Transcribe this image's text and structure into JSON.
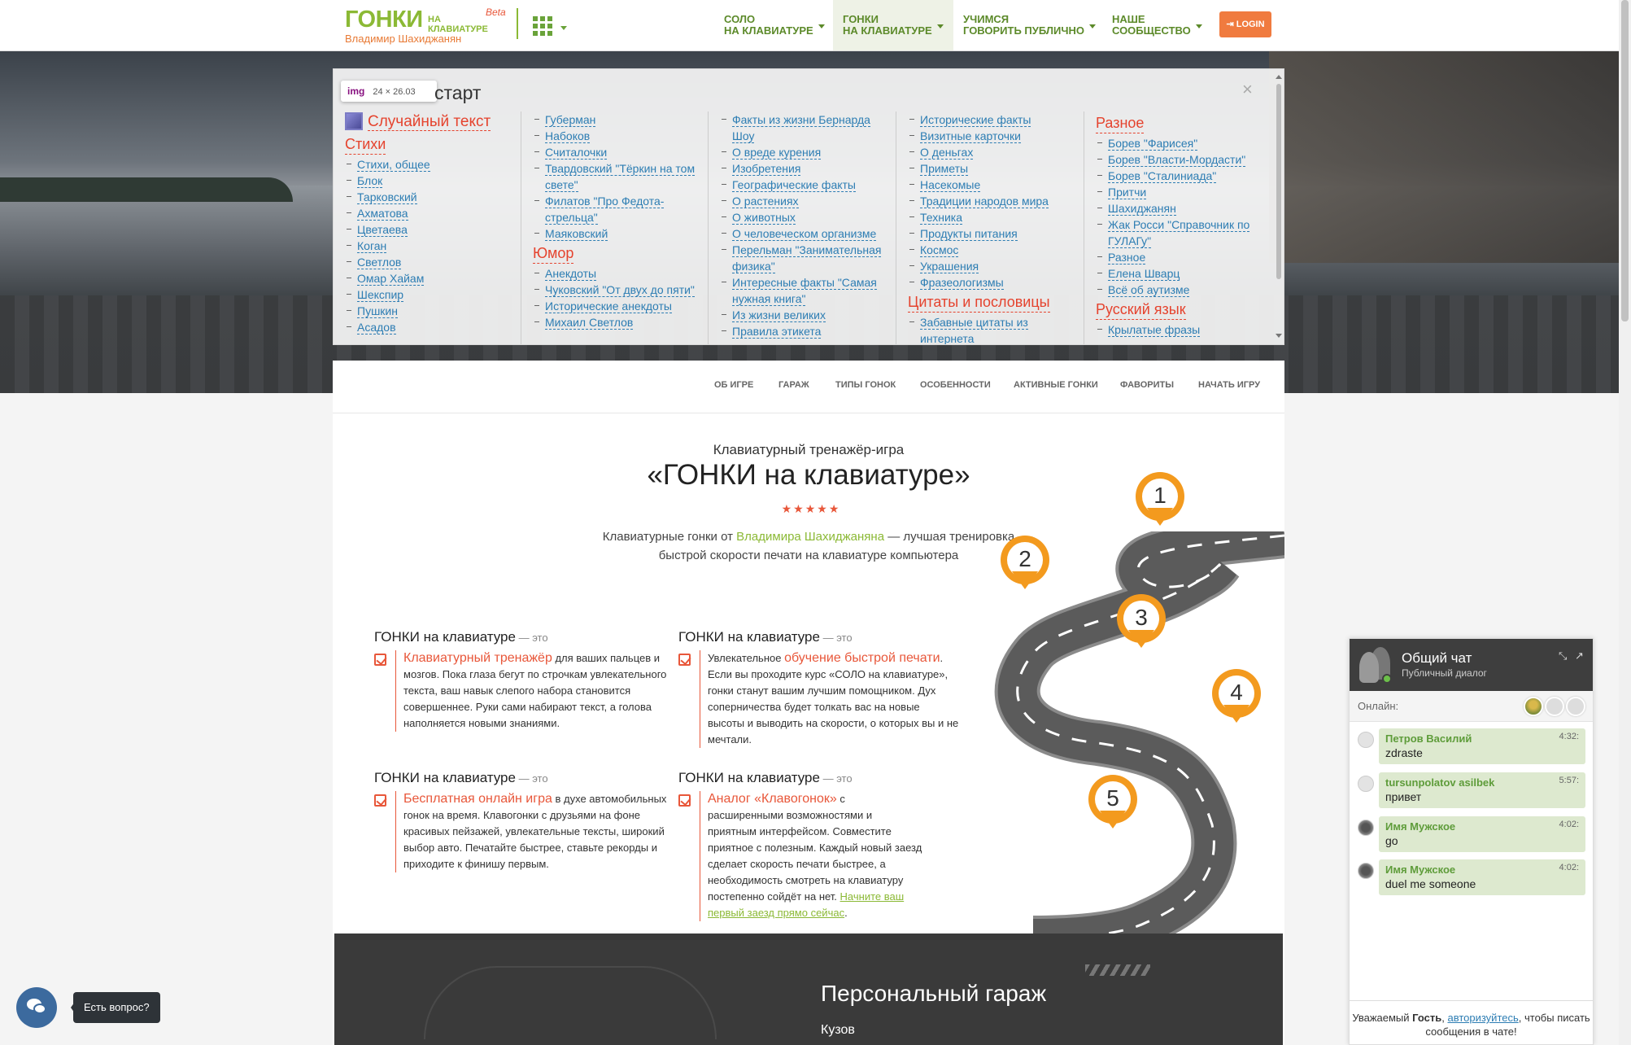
{
  "header": {
    "logo_big": "ГОНКИ",
    "logo_small_1": "НА",
    "logo_small_2": "КЛАВИАТУРЕ",
    "logo_author": "Владимир Шахиджанян",
    "logo_beta": "Beta",
    "apps_icon": "grid-icon",
    "nav": [
      {
        "line1": "СОЛО",
        "line2": "НА КЛАВИАТУРЕ"
      },
      {
        "line1": "ГОНКИ",
        "line2": "НА КЛАВИАТУРЕ"
      },
      {
        "line1": "УЧИМСЯ",
        "line2": "ГОВОРИТЬ ПУБЛИЧНО"
      },
      {
        "line1": "НАШЕ",
        "line2": "СООБЩЕСТВО"
      }
    ],
    "login_label": "LOGIN",
    "login_icon": "sign-in-icon",
    "colors": {
      "brand_green": "#8bb935",
      "accent_orange": "#f07b3f"
    }
  },
  "popup": {
    "title": "старт",
    "tooltip_tag": "img",
    "tooltip_size": "24 × 26.03",
    "random_text": "Случайный текст",
    "col1": {
      "heading": "Стихи",
      "items": [
        "Стихи, общее",
        "Блок",
        "Тарковский",
        "Ахматова",
        "Цветаева",
        "Коган",
        "Светлов",
        "Омар Хайам",
        "Шекспир",
        "Пушкин",
        "Асадов"
      ]
    },
    "col2": {
      "items_a": [
        "Губерман",
        "Набоков",
        "Считалочки",
        "Твардовский \"Тёркин на том свете\"",
        "Филатов \"Про Федота-стрельца\"",
        "Маяковский"
      ],
      "heading": "Юмор",
      "items_b": [
        "Анекдоты",
        "Чуковский \"От двух до пяти\"",
        "Исторические анекдоты",
        "Михаил Светлов"
      ]
    },
    "col3": {
      "items": [
        "Факты из жизни Бернарда Шоу",
        "О вреде курения",
        "Изобретения",
        "Географические факты",
        "О растениях",
        "О животных",
        "О человеческом организме",
        "Перельман \"Занимательная физика\"",
        "Интересные факты \"Самая нужная книга\"",
        "Из жизни великих",
        "Правила этикета"
      ]
    },
    "col4": {
      "items_a": [
        "Исторические факты",
        "Визитные карточки",
        "О деньгах",
        "Приметы",
        "Насекомые",
        "Традиции народов мира",
        "Техника",
        "Продукты питания",
        "Космос",
        "Украшения",
        "Фразеологизмы"
      ],
      "heading": "Цитаты и пословицы",
      "items_b": [
        "Забавные цитаты из интернета"
      ]
    },
    "col5": {
      "heading_a": "Разное",
      "items_a": [
        "Борев \"Фарисея\"",
        "Борев \"Власти-Мордасти\"",
        "Борев \"Сталиниада\"",
        "Притчи",
        "Шахиджанян",
        "Жак Росси \"Справочник по ГУЛАГу\"",
        "Разное",
        "Елена Шварц",
        "Всё об аутизме"
      ],
      "heading_b": "Русский язык",
      "items_b": [
        "Крылатые фразы"
      ]
    }
  },
  "subnav": [
    "ОБ ИГРЕ",
    "ГАРАЖ",
    "ТИПЫ ГОНОК",
    "ОСОБЕННОСТИ",
    "АКТИВНЫЕ ГОНКИ",
    "ФАВОРИТЫ",
    "НАЧАТЬ ИГРУ"
  ],
  "lead": {
    "subtitle": "Клавиатурный тренажёр-игра",
    "title": "«ГОНКИ на клавиатуре»",
    "stars": "★★★★★",
    "desc_1": "Клавиатурные гонки от ",
    "desc_author": "Владимира Шахиджаняна",
    "desc_2": " — лучшая тренировка быстрой скорости печати на клавиатуре компьютера"
  },
  "features": [
    {
      "head": "ГОНКИ на клавиатуре",
      "suffix": " — это",
      "accent": "Клавиатурный тренажёр",
      "text": " для ваших пальцев и мозгов. Пока глаза бегут по строчкам увлекательного текста, ваш навык слепого набора становится совершеннее. Руки сами набирают текст, а голова наполняется новыми знаниями."
    },
    {
      "head": "ГОНКИ на клавиатуре",
      "suffix": " — это",
      "pre": "Увлекательное ",
      "accent": "обучение быстрой печати",
      "text": ". Если вы проходите курс «СОЛО на клавиатуре», гонки станут вашим лучшим помощником. Дух соперничества будет толкать вас на новые высоты и выводить на скорости, о которых вы и не мечтали."
    },
    {
      "head": "ГОНКИ на клавиатуре",
      "suffix": " — это",
      "accent": "Бесплатная онлайн игра",
      "text": " в духе автомобильных гонок на время. Клавогонки с друзьями на фоне красивых пейзажей, увлекательные тексты, широкий выбор авто. Печатайте быстрее, ставьте рекорды и приходите к финишу первым."
    },
    {
      "head": "ГОНКИ на клавиатуре",
      "suffix": " — это",
      "accent": "Аналог «Клавогонок»",
      "text": " с расширенными возможностями и приятным интерфейсом. Совместите приятное с полезным. Каждый новый заезд сделает скорость печати быстрее, а необходимость смотреть на клавиатуру постепенно сойдёт на нет. ",
      "link": "Начните ваш первый заезд прямо сейчас",
      "tail": "."
    }
  ],
  "road_pins": [
    "1",
    "2",
    "3",
    "4",
    "5"
  ],
  "garage": {
    "title": "Персональный гараж",
    "sub": "Кузов"
  },
  "chat": {
    "title": "Общий чат",
    "subtitle": "Публичный диалог",
    "online_label": "Онлайн:",
    "messages": [
      {
        "name": "Петров Василий",
        "time": "4:32:",
        "text": "zdraste"
      },
      {
        "name": "tursunpolatov asilbek",
        "time": "5:57:",
        "text": "привет"
      },
      {
        "name": "Имя Мужское",
        "time": "4:02:",
        "text": "go"
      },
      {
        "name": "Имя Мужское",
        "time": "4:02:",
        "text": "duel me someone"
      }
    ],
    "foot_1": "Уважаемый ",
    "foot_guest": "Гость",
    "foot_2": ", ",
    "foot_link": "авторизуйтесь",
    "foot_3": ", чтобы писать сообщения в чате!"
  },
  "help": {
    "label": "Есть вопрос?",
    "icon": "chat-bubbles-icon"
  }
}
